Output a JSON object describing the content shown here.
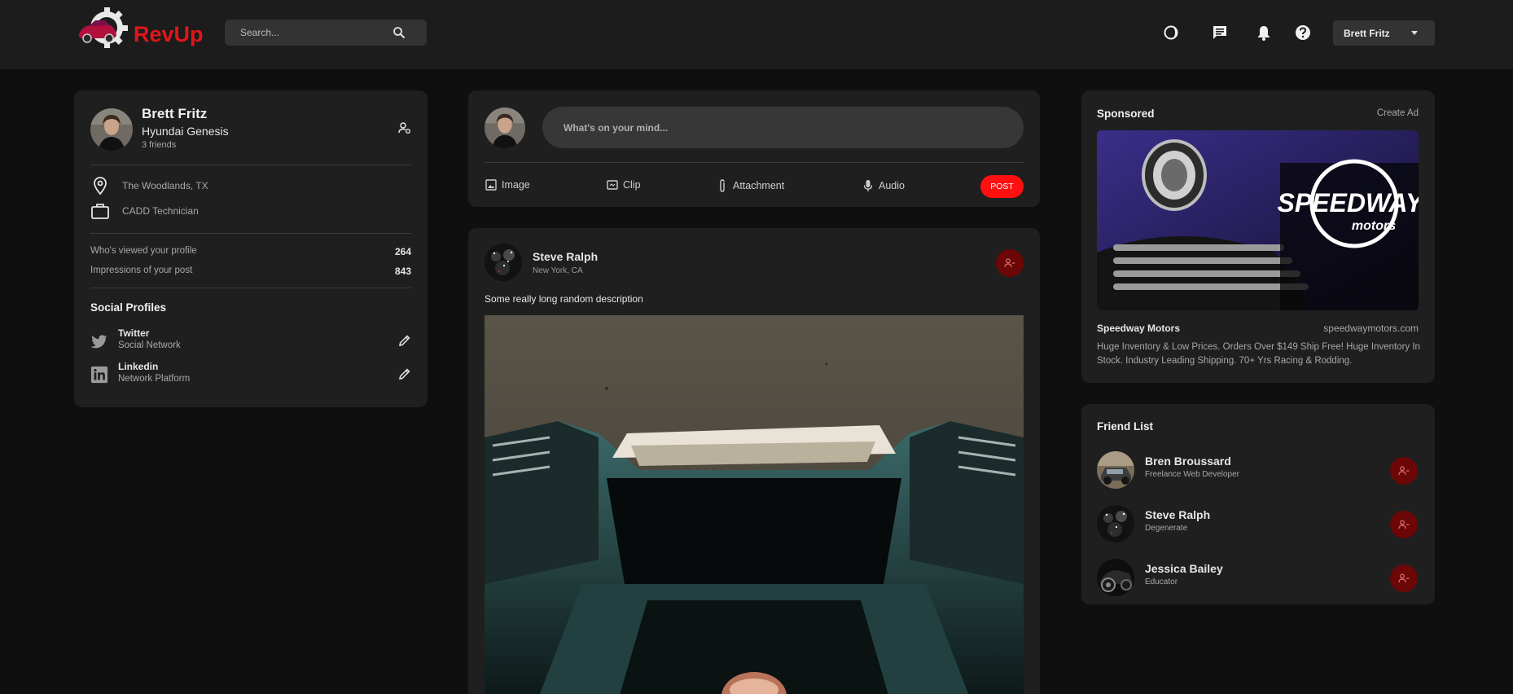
{
  "app": {
    "name": "RevUp"
  },
  "colors": {
    "brand": "#e0161b",
    "post_button": "#ff0f0f",
    "unfriend": "#6b0707",
    "card": "#1f1f1f",
    "navbar": "#1c1c1c"
  },
  "header": {
    "search_placeholder": "Search...",
    "icons": [
      "moon-icon",
      "chat-icon",
      "bell-icon",
      "help-icon"
    ],
    "user_menu": "Brett Fritz"
  },
  "profile": {
    "name": "Brett Fritz",
    "car": "Hyundai Genesis",
    "friends": "3 friends",
    "location": "The Woodlands, TX",
    "occupation": "CADD Technician",
    "stats": [
      {
        "label": "Who's viewed your profile",
        "value": "264"
      },
      {
        "label": "Impressions of your post",
        "value": "843"
      }
    ],
    "social_title": "Social Profiles",
    "socials": [
      {
        "name": "Twitter",
        "subtitle": "Social Network",
        "icon": "twitter-icon"
      },
      {
        "name": "Linkedin",
        "subtitle": "Network Platform",
        "icon": "linkedin-icon"
      }
    ]
  },
  "composer": {
    "placeholder": "What's on your mind...",
    "actions": [
      {
        "label": "Image",
        "icon": "image-icon"
      },
      {
        "label": "Clip",
        "icon": "clip-icon"
      },
      {
        "label": "Attachment",
        "icon": "paperclip-icon"
      },
      {
        "label": "Audio",
        "icon": "microphone-icon"
      }
    ],
    "post_label": "POST"
  },
  "post": {
    "author": "Steve Ralph",
    "location": "New York, CA",
    "description": "Some really long random description"
  },
  "sponsored": {
    "title": "Sponsored",
    "create_ad": "Create Ad",
    "ad_logo_text": "SPEEDWAY",
    "ad_logo_sub": "motors",
    "name": "Speedway Motors",
    "url": "speedwaymotors.com",
    "description": "Huge Inventory & Low Prices. Orders Over $149 Ship Free! Huge Inventory In Stock. Industry Leading Shipping. 70+ Yrs Racing & Rodding."
  },
  "friend_list": {
    "title": "Friend List",
    "friends": [
      {
        "name": "Bren Broussard",
        "subtitle": "Freelance Web Developer"
      },
      {
        "name": "Steve Ralph",
        "subtitle": "Degenerate"
      },
      {
        "name": "Jessica Bailey",
        "subtitle": "Educator"
      }
    ]
  }
}
